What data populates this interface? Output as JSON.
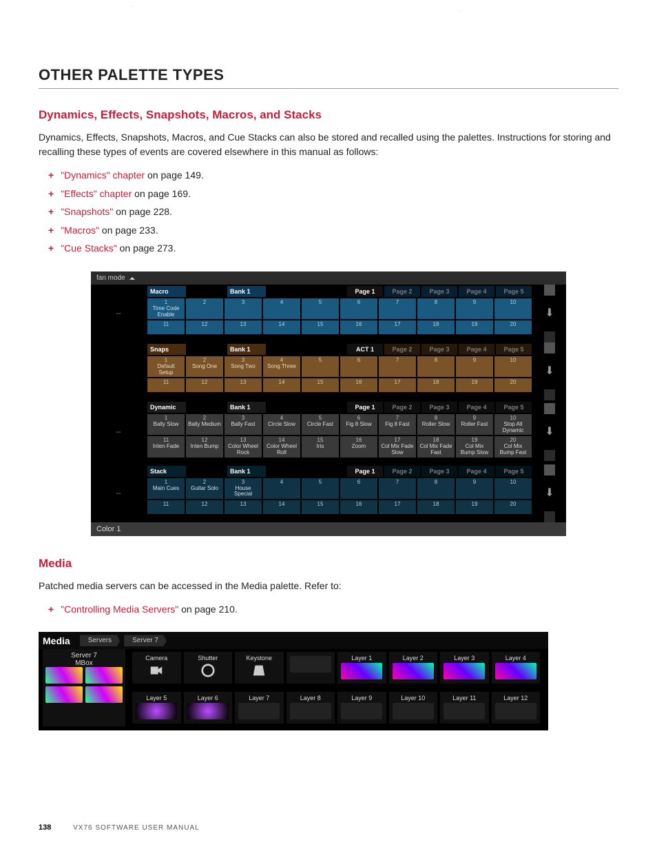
{
  "h1": "OTHER PALETTE TYPES",
  "h2a": "Dynamics, Effects, Snapshots, Macros, and Stacks",
  "intro": "Dynamics, Effects, Snapshots, Macros, and Cue Stacks can also be stored and recalled using the palettes. Instructions for storing and recalling these types of events are covered elsewhere in this manual as follows:",
  "links": [
    {
      "t": "\"Dynamics\" chapter",
      "s": " on page 149."
    },
    {
      "t": "\"Effects\" chapter",
      "s": " on page 169."
    },
    {
      "t": "\"Snapshots\"",
      "s": " on page 228."
    },
    {
      "t": "\"Macros\"",
      "s": " on page 233."
    },
    {
      "t": "\"Cue Stacks\"",
      "s": " on page 273."
    }
  ],
  "fan": "fan mode",
  "leftdash": "--",
  "colorbar": "Color 1",
  "pageLabels": [
    "Page 1",
    "Page 2",
    "Page 3",
    "Page 4",
    "Page 5"
  ],
  "sections": [
    {
      "theme": "macro",
      "title": "Macro",
      "bank": "Bank 1",
      "activePage": "Page 1",
      "r1": [
        {
          "n": "1",
          "l": "Time Code Enable"
        },
        {
          "n": "2"
        },
        {
          "n": "3"
        },
        {
          "n": "4"
        },
        {
          "n": "5"
        },
        {
          "n": "6"
        },
        {
          "n": "7"
        },
        {
          "n": "8"
        },
        {
          "n": "9"
        },
        {
          "n": "10"
        }
      ],
      "r2": [
        {
          "n": "11"
        },
        {
          "n": "12"
        },
        {
          "n": "13"
        },
        {
          "n": "14"
        },
        {
          "n": "15"
        },
        {
          "n": "16"
        },
        {
          "n": "17"
        },
        {
          "n": "18"
        },
        {
          "n": "19"
        },
        {
          "n": "20"
        }
      ]
    },
    {
      "theme": "snaps",
      "title": "Snaps",
      "bank": "Bank 1",
      "activePage": "ACT 1",
      "r1": [
        {
          "n": "1",
          "l": "Default Setup"
        },
        {
          "n": "2",
          "l": "Song One"
        },
        {
          "n": "3",
          "l": "Song Two"
        },
        {
          "n": "4",
          "l": "Song Three"
        },
        {
          "n": "5"
        },
        {
          "n": "6"
        },
        {
          "n": "7"
        },
        {
          "n": "8"
        },
        {
          "n": "9"
        },
        {
          "n": "10"
        }
      ],
      "r2": [
        {
          "n": "11"
        },
        {
          "n": "12"
        },
        {
          "n": "13"
        },
        {
          "n": "14"
        },
        {
          "n": "15"
        },
        {
          "n": "16"
        },
        {
          "n": "17"
        },
        {
          "n": "18"
        },
        {
          "n": "19"
        },
        {
          "n": "20"
        }
      ]
    },
    {
      "theme": "dyn",
      "title": "Dynamic",
      "bank": "Bank 1",
      "activePage": "Page 1",
      "r1": [
        {
          "n": "1",
          "l": "Bally Slow"
        },
        {
          "n": "2",
          "l": "Bally Medium"
        },
        {
          "n": "3",
          "l": "Bally Fast"
        },
        {
          "n": "4",
          "l": "Circle Slow"
        },
        {
          "n": "5",
          "l": "Circle Fast"
        },
        {
          "n": "6",
          "l": "Fig 8 Slow"
        },
        {
          "n": "7",
          "l": "Fig 8 Fast"
        },
        {
          "n": "8",
          "l": "Roller Slow"
        },
        {
          "n": "9",
          "l": "Roller Fast"
        },
        {
          "n": "10",
          "l": "Stop All Dynamic"
        }
      ],
      "r2": [
        {
          "n": "11",
          "l": "Inten Fade"
        },
        {
          "n": "12",
          "l": "Inten Bump"
        },
        {
          "n": "13",
          "l": "Color Wheel Rock"
        },
        {
          "n": "14",
          "l": "Color Wheel Roll"
        },
        {
          "n": "15",
          "l": "Iris"
        },
        {
          "n": "16",
          "l": "Zoom"
        },
        {
          "n": "17",
          "l": "Col Mix Fade Slow"
        },
        {
          "n": "18",
          "l": "Col Mix Fade Fast"
        },
        {
          "n": "19",
          "l": "Col Mix Bump Slow"
        },
        {
          "n": "20",
          "l": "Col Mix Bump Fast"
        }
      ]
    },
    {
      "theme": "stack",
      "title": "Stack",
      "bank": "Bank 1",
      "activePage": "Page 1",
      "r1": [
        {
          "n": "1",
          "l": "Main Cues"
        },
        {
          "n": "2",
          "l": "Guitar Solo"
        },
        {
          "n": "3",
          "l": "House Special"
        },
        {
          "n": "4"
        },
        {
          "n": "5"
        },
        {
          "n": "6"
        },
        {
          "n": "7"
        },
        {
          "n": "8"
        },
        {
          "n": "9"
        },
        {
          "n": "10"
        }
      ],
      "r2": [
        {
          "n": "11"
        },
        {
          "n": "12"
        },
        {
          "n": "13"
        },
        {
          "n": "14"
        },
        {
          "n": "15"
        },
        {
          "n": "16"
        },
        {
          "n": "17"
        },
        {
          "n": "18"
        },
        {
          "n": "19"
        },
        {
          "n": "20"
        }
      ]
    }
  ],
  "h2b": "Media",
  "mediaIntro": "Patched media servers can be accessed in the Media palette. Refer to:",
  "mediaLink": {
    "t": "\"Controlling Media Servers\"",
    "s": " on page 210."
  },
  "media": {
    "title": "Media",
    "crumb1": "Servers",
    "crumb2": "Server 7",
    "server": {
      "name": "Server 7",
      "sub": "MBox"
    },
    "row1": [
      "Camera",
      "Shutter",
      "Keystone",
      "",
      "Layer 1",
      "Layer 2",
      "Layer 3",
      "Layer 4"
    ],
    "row2": [
      "Layer 5",
      "Layer 6",
      "Layer 7",
      "Layer 8",
      "Layer 9",
      "Layer 10",
      "Layer 11",
      "Layer 12"
    ]
  },
  "footer": {
    "page": "138",
    "title": "VX76 SOFTWARE USER MANUAL"
  }
}
